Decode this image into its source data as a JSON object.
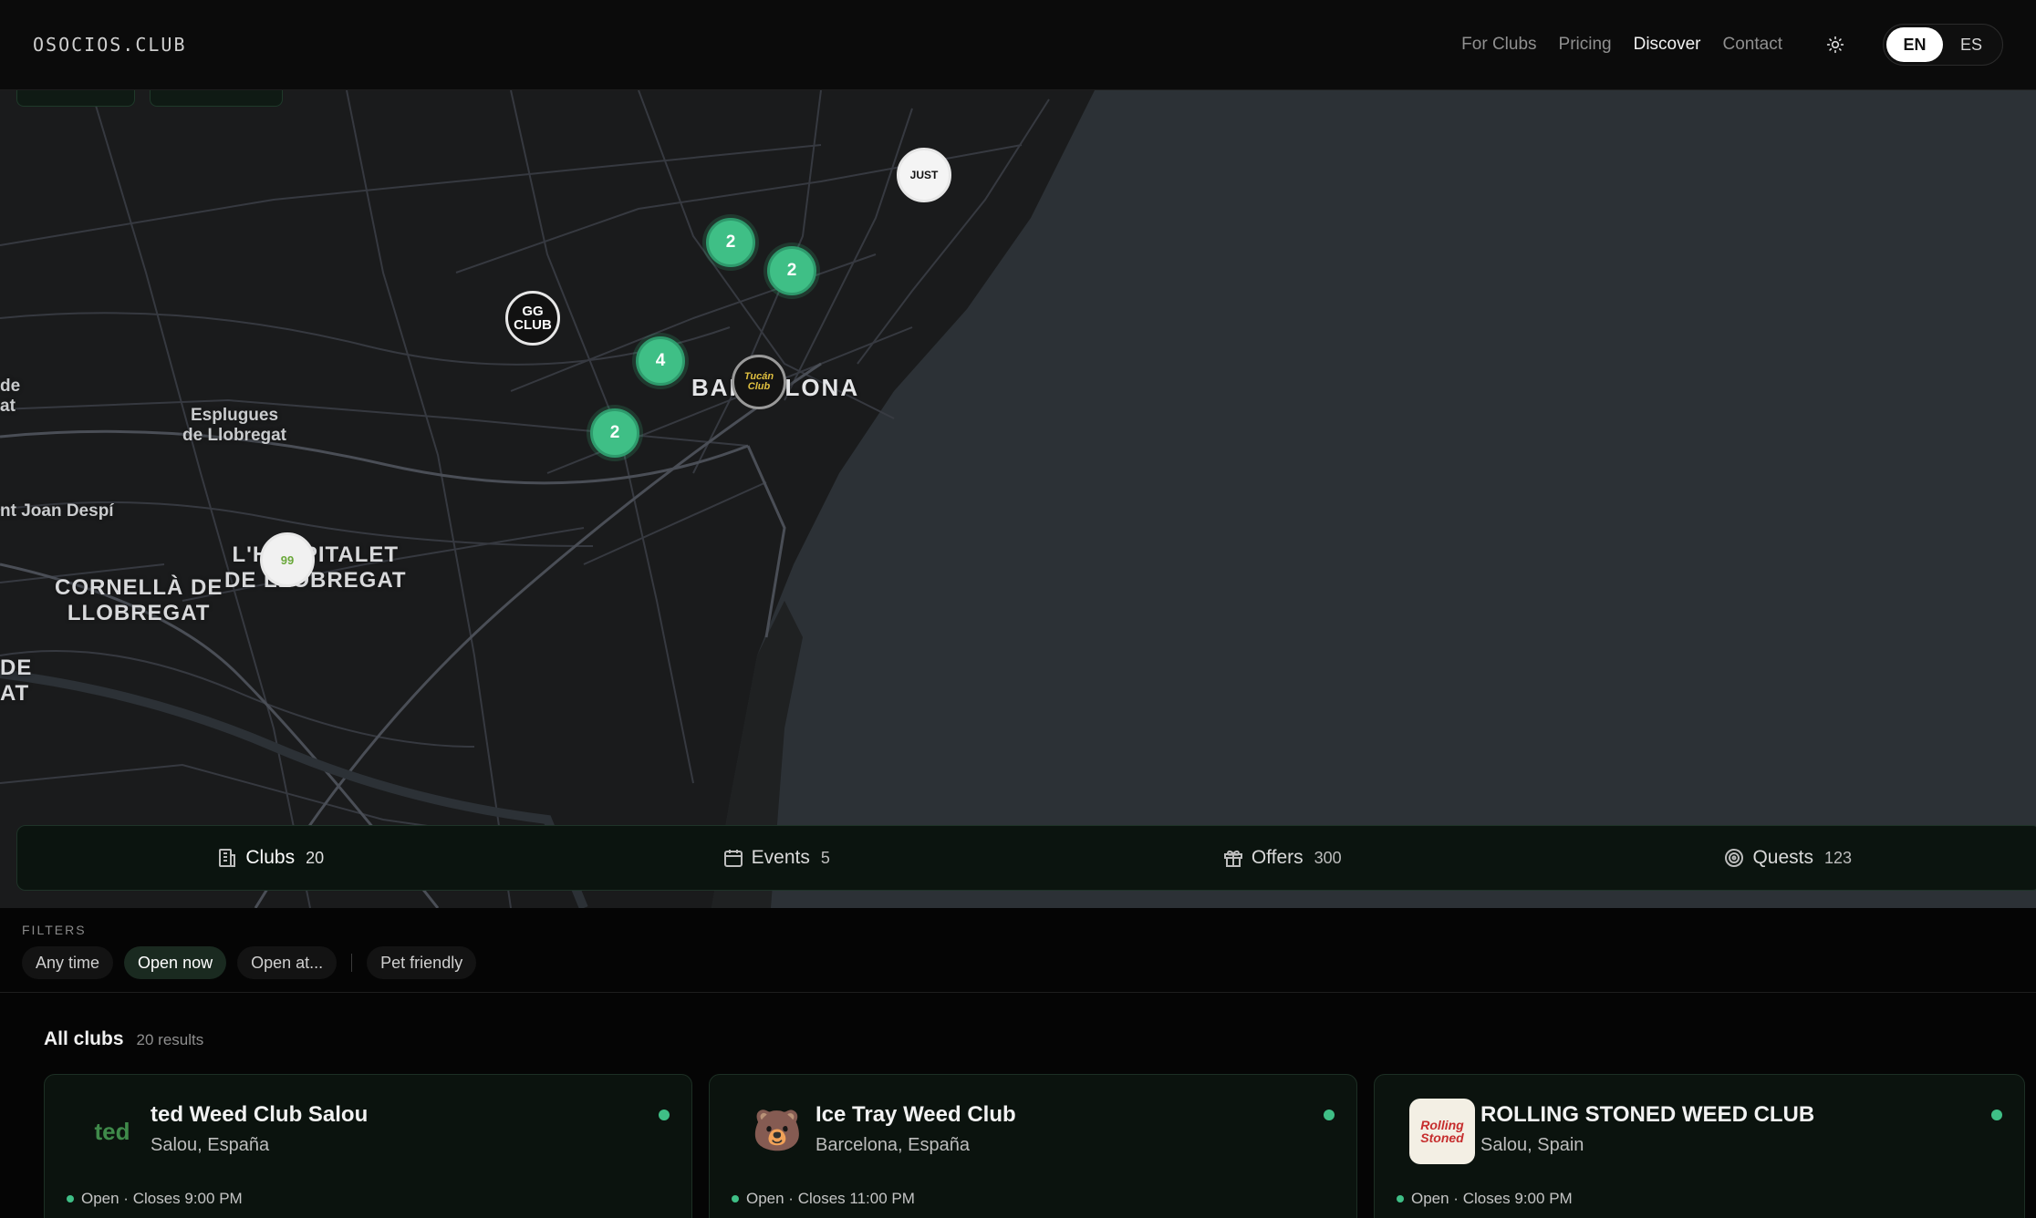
{
  "header": {
    "logo": "OSOCIOS.CLUB",
    "nav": [
      "For Clubs",
      "Pricing",
      "Discover",
      "Contact"
    ],
    "active_nav": "Discover",
    "theme_icon": "sun-icon",
    "languages": [
      "EN",
      "ES"
    ],
    "active_language": "EN"
  },
  "map": {
    "labels": {
      "esplugues": "Esplugues\nde Llobregat",
      "sant_joan": "nt Joan Despí",
      "cornella": "CORNELLÀ DE\nLLOBREGAT",
      "hospitalet": "L'HOSPITALET\nDE LLOBREGAT",
      "barcelona": "BARCELONA",
      "left_de": "de\nat",
      "left_de2": "DE\nAT"
    },
    "clusters": [
      "2",
      "2",
      "4",
      "2"
    ],
    "pins": {
      "gg": "GG\nCLUB",
      "just": "JUST",
      "tucan": "Tucán\nClub",
      "hosp": "99"
    },
    "colors": {
      "cluster": "#3fbf86",
      "water": "#2c3136",
      "land": "#1a1b1c"
    }
  },
  "tabs": [
    {
      "label": "Clubs",
      "count": "20",
      "icon": "building-icon"
    },
    {
      "label": "Events",
      "count": "5",
      "icon": "calendar-icon"
    },
    {
      "label": "Offers",
      "count": "300",
      "icon": "gift-icon"
    },
    {
      "label": "Quests",
      "count": "123",
      "icon": "target-icon"
    }
  ],
  "filters": {
    "label": "FILTERS",
    "chips": [
      "Any time",
      "Open now",
      "Open at...",
      "Pet friendly"
    ],
    "active": "Open now"
  },
  "results": {
    "title": "All clubs",
    "count": "20 results"
  },
  "cards": [
    {
      "name": "ted Weed Club Salou",
      "location": "Salou, España",
      "status": "Open · Closes 9:00 PM",
      "logo_text": "ted"
    },
    {
      "name": "Ice Tray Weed Club",
      "location": "Barcelona, España",
      "status": "Open · Closes 11:00 PM",
      "logo_text": "🐻"
    },
    {
      "name": "ROLLING STONED WEED CLUB",
      "location": "Salou, Spain",
      "status": "Open · Closes 9:00 PM",
      "logo_text": "Rolling\nStoned"
    }
  ]
}
